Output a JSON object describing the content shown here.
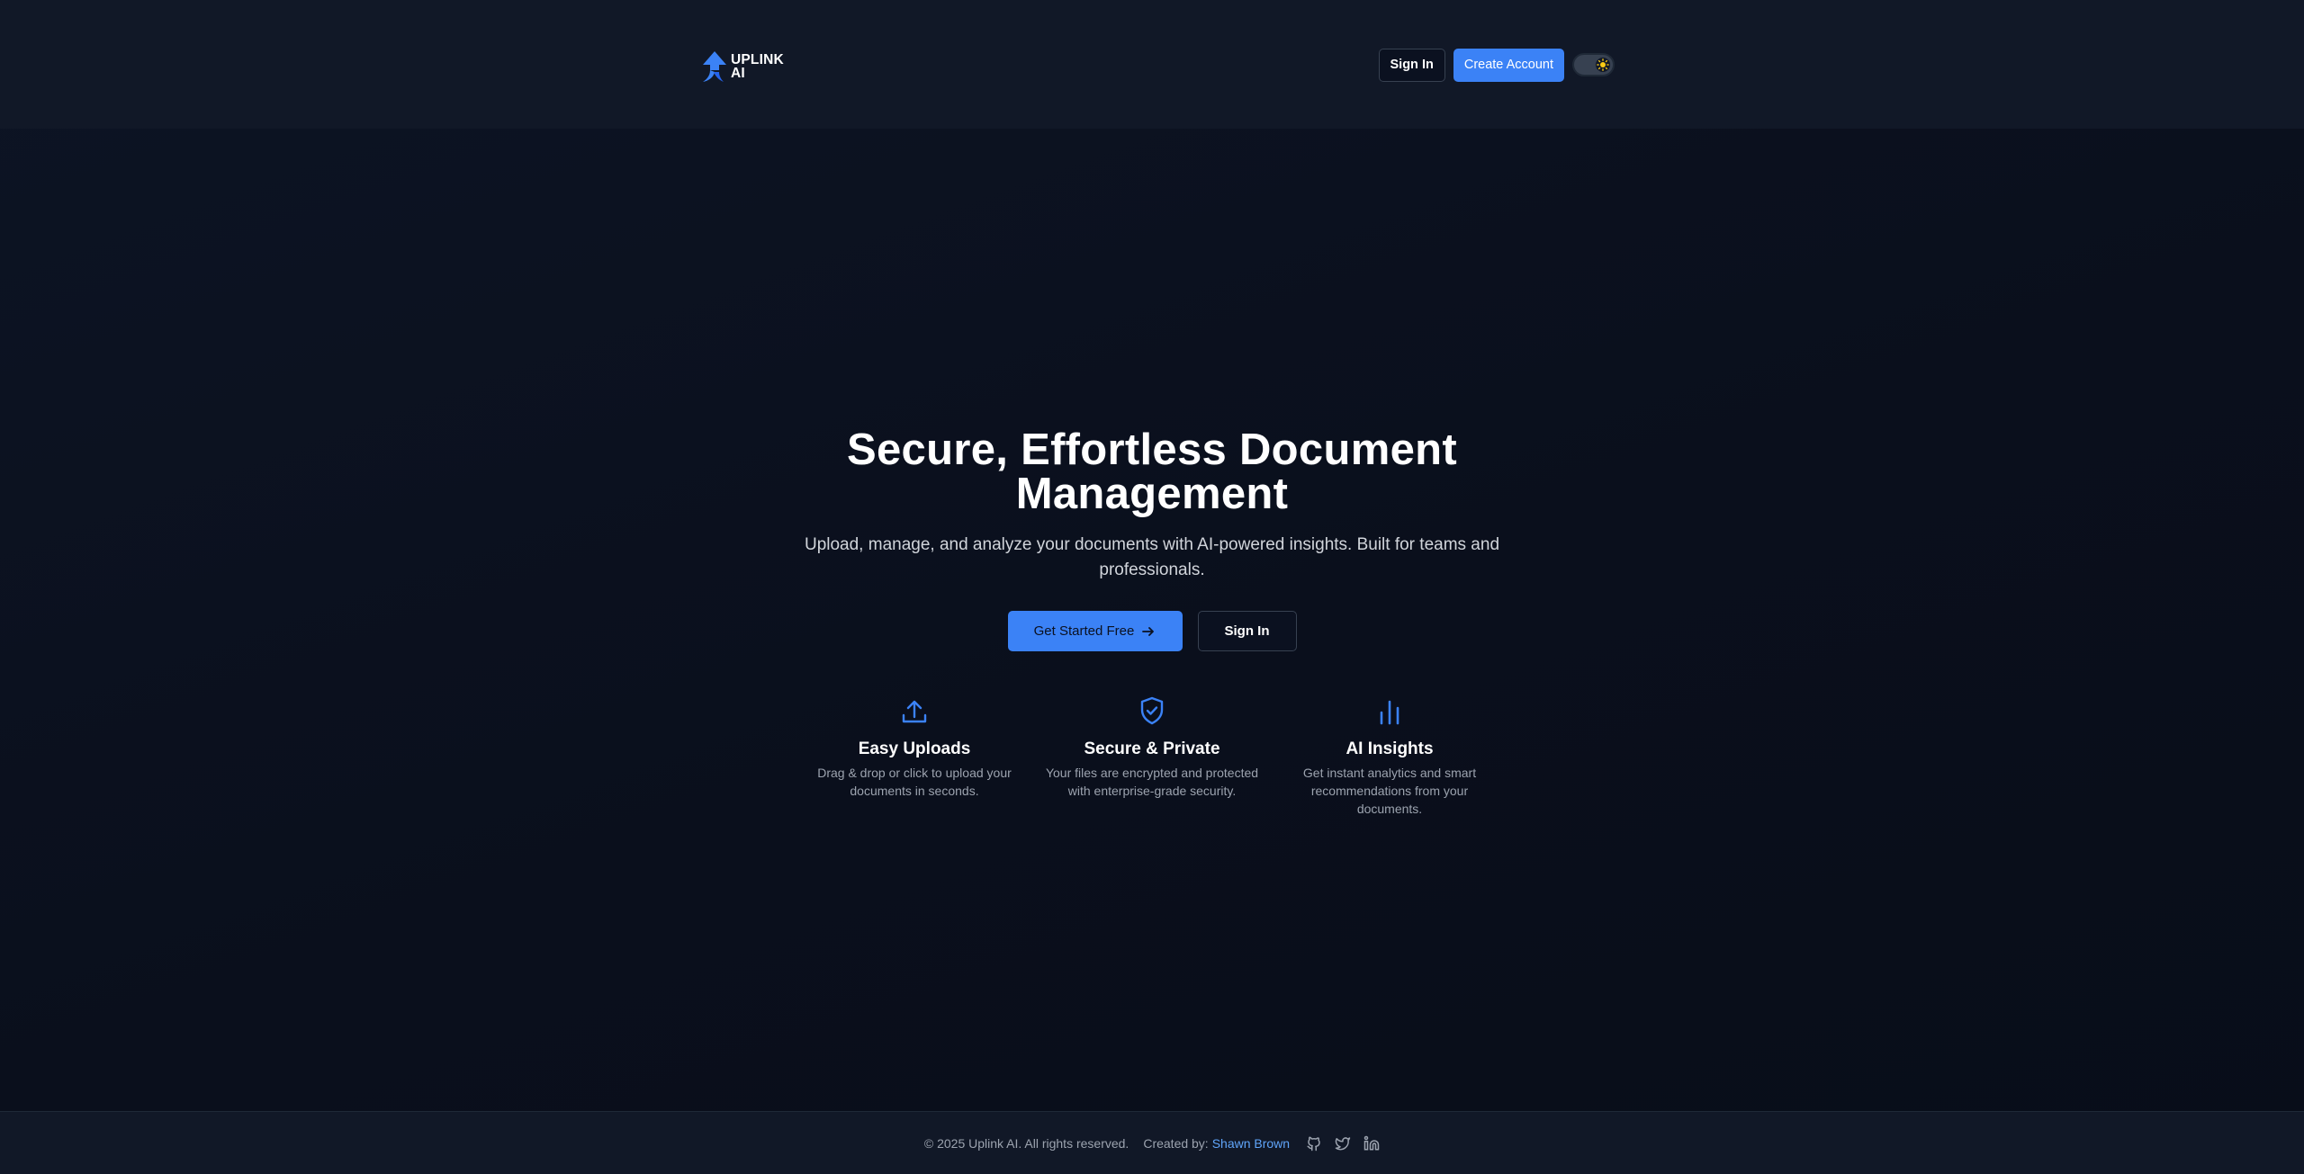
{
  "app": {
    "brand_line1": "UPLINK",
    "brand_line2": "AI"
  },
  "header": {
    "sign_in_label": "Sign In",
    "create_account_label": "Create Account",
    "theme_toggle_icon": "sun-icon"
  },
  "hero": {
    "title": "Secure, Effortless Document Management",
    "subtitle": "Upload, manage, and analyze your documents with AI-powered insights. Built for teams and professionals.",
    "primary_cta": "Get Started Free",
    "primary_cta_icon": "arrow-right-icon",
    "secondary_cta": "Sign In"
  },
  "features": [
    {
      "icon": "upload-icon",
      "title": "Easy Uploads",
      "description": "Drag & drop or click to upload your documents in seconds."
    },
    {
      "icon": "shield-check-icon",
      "title": "Secure & Private",
      "description": "Your files are encrypted and protected with enterprise-grade security."
    },
    {
      "icon": "bar-chart-icon",
      "title": "AI Insights",
      "description": "Get instant analytics and smart recommendations from your documents."
    }
  ],
  "footer": {
    "copyright": "© 2025 Uplink AI. All rights reserved.",
    "created_by_label": "Created by:",
    "author": "Shawn Brown",
    "social": [
      "github-icon",
      "twitter-icon",
      "linkedin-icon"
    ]
  },
  "colors": {
    "accent": "#3b82f6",
    "header_bg": "#111827",
    "page_bg": "#0a0f1c",
    "link": "#60a5fa"
  }
}
